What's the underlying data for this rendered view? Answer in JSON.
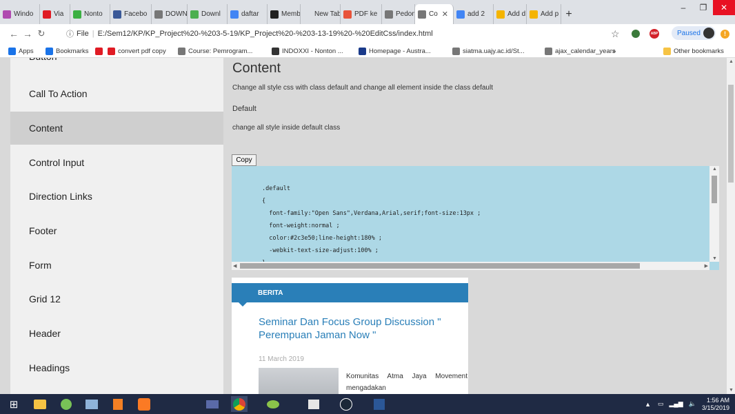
{
  "browser": {
    "tabs": [
      {
        "label": "Windo",
        "color": "#b04ab0"
      },
      {
        "label": "Via",
        "color": "#e01b24"
      },
      {
        "label": "Nonto",
        "color": "#3cb043"
      },
      {
        "label": "Facebo",
        "color": "#3b5998"
      },
      {
        "label": "DOWN",
        "color": "#777777"
      },
      {
        "label": "Downl",
        "color": "#4caf50"
      },
      {
        "label": "daftar",
        "color": "#4285f4"
      },
      {
        "label": "Memb",
        "color": "#222222"
      },
      {
        "label": "New Tab",
        "color": "#dee1e6"
      },
      {
        "label": "PDF ke",
        "color": "#e8533a"
      },
      {
        "label": "Pedom",
        "color": "#777777"
      },
      {
        "label": "Co",
        "color": "#777777"
      },
      {
        "label": "add 2",
        "color": "#4285f4"
      },
      {
        "label": "Add d",
        "color": "#f4b400"
      },
      {
        "label": "Add p",
        "color": "#f4b400"
      }
    ],
    "active_tab_index": 11,
    "address": {
      "scheme_label": "File",
      "url": "E:/Sem12/KP/KP_Project%20-%203-5-19/KP_Project%20-%203-13-19%20-%20EditCss/index.html"
    },
    "profile_status": "Paused",
    "bookmarks": [
      {
        "label": "Apps",
        "icon": "apps-icon",
        "color": "#1a73e8"
      },
      {
        "label": "Bookmarks",
        "icon": "star-icon",
        "color": "#1a73e8"
      },
      {
        "label": "",
        "icon": "youtube-icon",
        "color": "#e01b24"
      },
      {
        "label": "convert pdf copy",
        "icon": "s-icon",
        "color": "#e01b24"
      },
      {
        "label": "Course: Pemrogram...",
        "icon": "page-icon",
        "color": "#777777"
      },
      {
        "label": "INDOXXI - Nonton ...",
        "icon": "xxi-icon",
        "color": "#333333"
      },
      {
        "label": "Homepage - Austra...",
        "icon": "asterisk-icon",
        "color": "#1a3a8a"
      },
      {
        "label": "siatma.uajy.ac.id/St...",
        "icon": "page-icon",
        "color": "#777777"
      },
      {
        "label": "ajax_calendar_years",
        "icon": "page-icon",
        "color": "#777777"
      }
    ],
    "bookmarks_overflow": "»",
    "other_bookmarks": "Other bookmarks"
  },
  "sidebar": {
    "items": [
      {
        "label": "Button"
      },
      {
        "label": "Call To Action"
      },
      {
        "label": "Content"
      },
      {
        "label": "Control Input"
      },
      {
        "label": "Direction Links"
      },
      {
        "label": "Footer"
      },
      {
        "label": "Form"
      },
      {
        "label": "Grid 12"
      },
      {
        "label": "Header"
      },
      {
        "label": "Headings"
      }
    ],
    "active_index": 2
  },
  "main": {
    "title": "Content",
    "description": "Change all style css with class default and change all element inside the class default",
    "class_name": "Default",
    "class_description": "change all style inside default class",
    "copy_label": "Copy",
    "code": ".default\n{\n  font-family:\"Open Sans\",Verdana,Arial,serif;font-size:13px ;\n  font-weight:normal ;\n  color:#2c3e50;line-height:180% ;\n  -webkit-text-size-adjust:100% ;\n}",
    "card": {
      "header": "BERITA",
      "title": "Seminar Dan Focus Group Discussion \" Perempuan Jaman Now \"",
      "date": "11 March 2019",
      "excerpt": "Komunitas Atma Jaya Movement mengadakan"
    }
  },
  "taskbar": {
    "time": "1:56 AM",
    "date": "3/15/2019"
  }
}
